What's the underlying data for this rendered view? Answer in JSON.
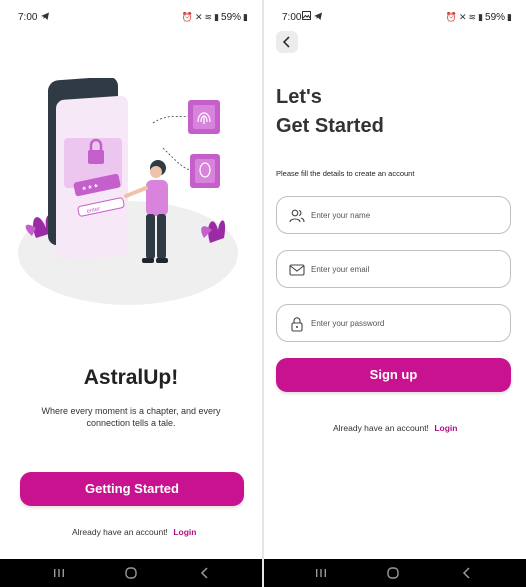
{
  "status_bar": {
    "time": "7:00",
    "battery": "59%"
  },
  "welcome": {
    "app_name": "AstralUp!",
    "tagline": "Where every moment is a chapter, and every connection tells a tale.",
    "cta_label": "Getting Started",
    "account_prompt": "Already have an account!",
    "login_label": "Login",
    "illustration": {
      "password_mask": "* * *",
      "entry_label": "enter"
    }
  },
  "signup": {
    "heading_line1": "Let's",
    "heading_line2": "Get Started",
    "subtitle": "Please fill the details to create an account",
    "fields": {
      "name": {
        "placeholder": "Enter your name",
        "icon": "users-icon"
      },
      "email": {
        "placeholder": "Enter your email",
        "icon": "mail-icon"
      },
      "password": {
        "placeholder": "Enter your password",
        "icon": "lock-icon"
      }
    },
    "submit_label": "Sign up",
    "account_prompt": "Already have an account!",
    "login_label": "Login"
  },
  "nav": {
    "recents_icon": "recents-icon",
    "home_icon": "home-icon",
    "back_icon": "back-icon"
  },
  "colors": {
    "accent": "#c8128f",
    "link": "#b0107f",
    "illustration_purple": "#c45fcb",
    "illustration_light": "#ecc6ee",
    "phone_dark": "#2f3a45",
    "field_border": "#bfbfbf"
  }
}
